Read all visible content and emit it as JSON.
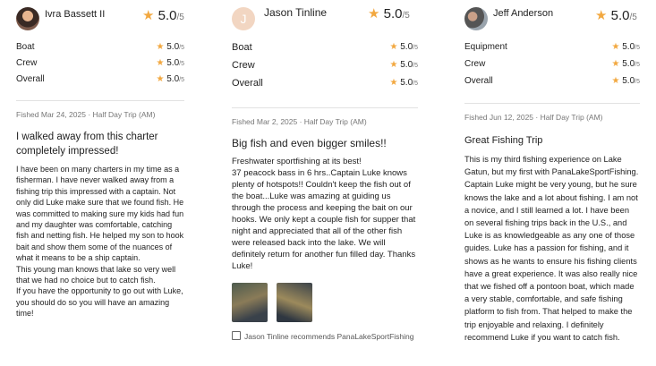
{
  "reviews": [
    {
      "reviewer": "Ivra Bassett II",
      "avatar_letter": "",
      "overall_score": "5.0",
      "overall_max": "/5",
      "ratings": [
        {
          "label": "Boat",
          "score": "5.0",
          "max": "/5"
        },
        {
          "label": "Crew",
          "score": "5.0",
          "max": "/5"
        },
        {
          "label": "Overall",
          "score": "5.0",
          "max": "/5"
        }
      ],
      "meta": "Fished Mar 24, 2025 · Half Day Trip (AM)",
      "title": "I walked away from this charter completely impressed!",
      "body": "I have been on many charters in my time as a fisherman. I have never walked away from a fishing trip this impressed with a captain. Not only did Luke make sure that we found fish. He was committed to making sure my kids had fun and my daughter was comfortable, catching fish and netting fish. He helped my son to hook bait and show them some of the nuances of what it means to be a ship captain.\nThis young man knows that lake so very well that we had no choice but to catch fish.\nIf you have the opportunity to go out with Luke, you should do so you will have an amazing time!"
    },
    {
      "reviewer": "Jason Tinline",
      "avatar_letter": "J",
      "overall_score": "5.0",
      "overall_max": "/5",
      "ratings": [
        {
          "label": "Boat",
          "score": "5.0",
          "max": "/5"
        },
        {
          "label": "Crew",
          "score": "5.0",
          "max": "/5"
        },
        {
          "label": "Overall",
          "score": "5.0",
          "max": "/5"
        }
      ],
      "meta": "Fished Mar 2, 2025 · Half Day Trip (AM)",
      "title": "Big fish and even bigger smiles!!",
      "body": "Freshwater sportfishing at its best!\n37 peacock bass in 6 hrs..Captain Luke knows plenty of hotspots!! Couldn't keep the fish out of the boat...Luke was amazing at guiding us through the process and keeping the bait on our hooks. We only kept a couple fish for supper that night and appreciated that all of the other fish were released back into the lake. We will definitely return for another fun filled day. Thanks Luke!",
      "recommendation": "Jason Tinline recommends PanaLakeSportFishing"
    },
    {
      "reviewer": "Jeff Anderson",
      "avatar_letter": "",
      "overall_score": "5.0",
      "overall_max": "/5",
      "ratings": [
        {
          "label": "Equipment",
          "score": "5.0",
          "max": "/5"
        },
        {
          "label": "Crew",
          "score": "5.0",
          "max": "/5"
        },
        {
          "label": "Overall",
          "score": "5.0",
          "max": "/5"
        }
      ],
      "meta": "Fished Jun 12, 2025 · Half Day Trip (AM)",
      "title": "Great Fishing Trip",
      "body": "This is my third fishing experience on Lake Gatun, but my first with PanaLakeSportFishing. Captain Luke might be very young, but he sure knows the lake and a lot about fishing. I am not a novice, and I still learned a lot. I have been on several fishing trips back in the U.S., and Luke is as knowledgeable as any one of those guides. Luke has a passion for fishing, and it shows as he wants to ensure his fishing clients have a great experience. It was also really nice that we fished off a pontoon boat, which made a very stable, comfortable, and safe fishing platform to fish from. That helped to make the trip enjoyable and relaxing. I definitely recommend Luke if you want to catch fish."
    }
  ],
  "icons": {
    "star": "★"
  },
  "colors": {
    "star": "#f2a840",
    "muted": "#777777",
    "divider": "#e2e2e2"
  }
}
